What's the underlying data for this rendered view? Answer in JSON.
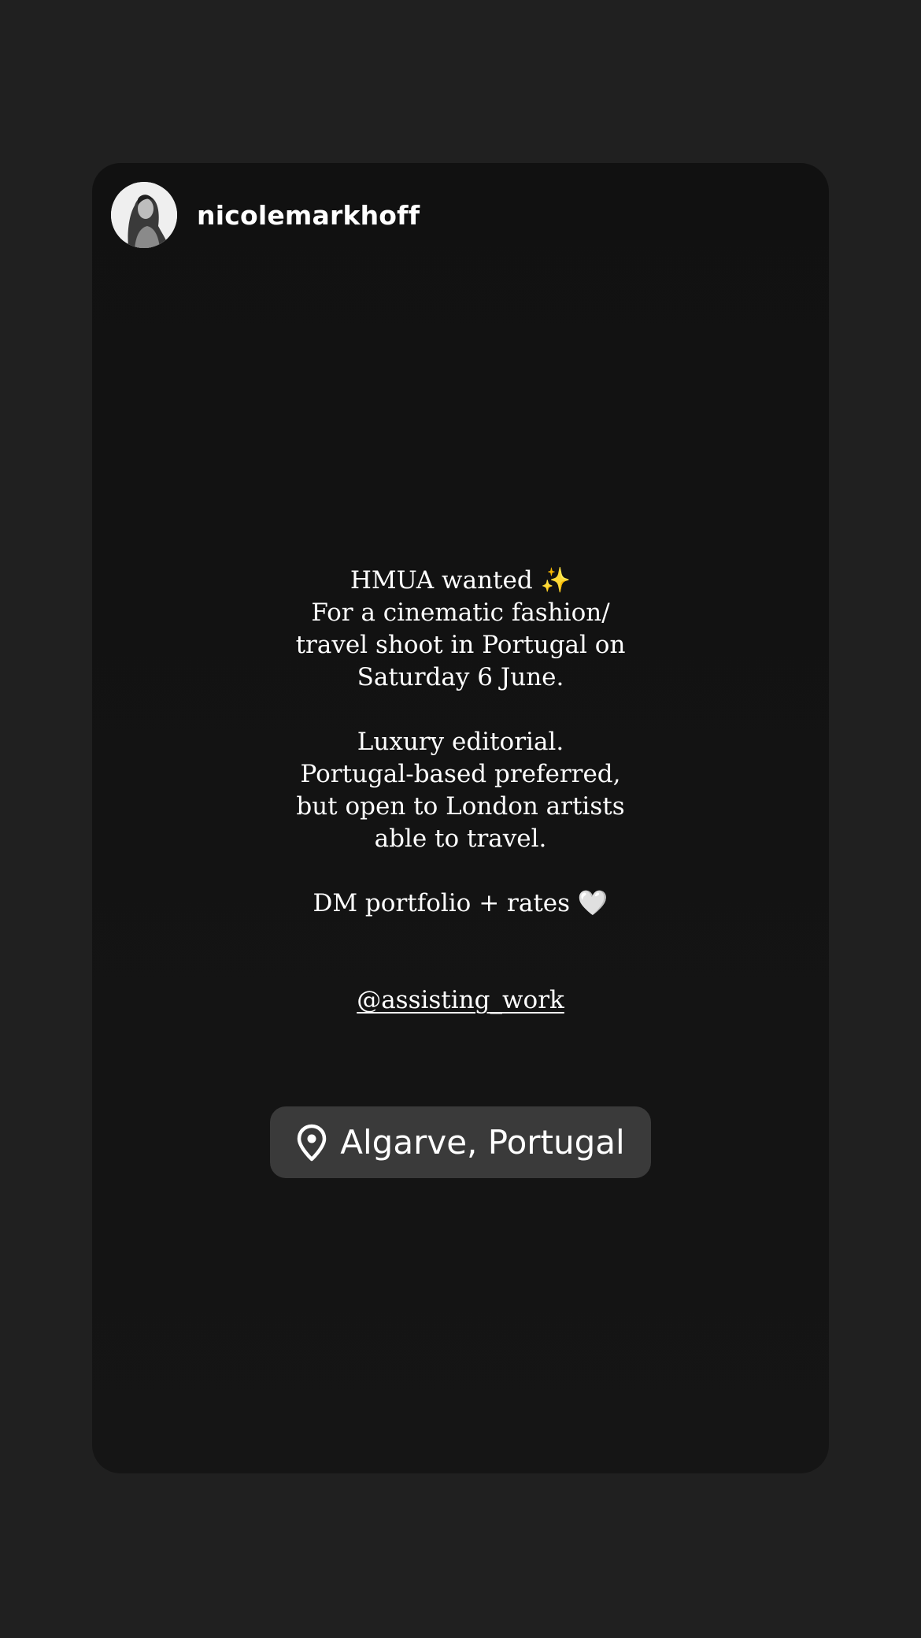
{
  "story": {
    "username": "nicolemarkhoff",
    "avatar_icon": "profile-photo-icon",
    "text_lines": [
      "HMUA wanted ✨",
      "For a cinematic fashion/",
      "travel shoot in Portugal on",
      "Saturday 6 June.",
      "",
      "Luxury editorial.",
      "Portugal-based preferred,",
      "but open to London artists",
      "able to travel.",
      "",
      "DM portfolio + rates 🤍"
    ],
    "mention": "@assisting_work",
    "location": {
      "icon": "location-pin-icon",
      "label": "Algarve, Portugal"
    }
  },
  "colors": {
    "page_background": "#202020",
    "card_background": "#131313",
    "sticker_background": "#3a3a3a",
    "text": "#ffffff"
  }
}
